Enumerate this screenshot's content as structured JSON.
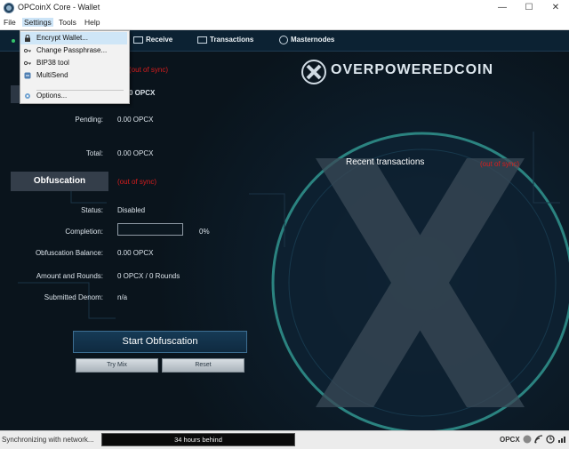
{
  "window": {
    "title": "OPCoinX Core - Wallet",
    "minimize": "—",
    "maximize": "☐",
    "close": "✕"
  },
  "menubar": [
    "File",
    "Settings",
    "Tools",
    "Help"
  ],
  "settings_menu": {
    "items": [
      "Encrypt Wallet...",
      "Change Passphrase...",
      "BIP38 tool",
      "MultiSend",
      "Options..."
    ]
  },
  "nav": {
    "receive": "Receive",
    "transactions": "Transactions",
    "masternodes": "Masternodes"
  },
  "overview": {
    "out_of_sync": "(out of sync)",
    "balance_partial": "0 OPCX",
    "pending_label": "Pending:",
    "pending_value": "0.00 OPCX",
    "total_label": "Total:",
    "total_value": "0.00 OPCX"
  },
  "obfuscation": {
    "header": "Obfuscation",
    "out_of_sync": "(out of sync)",
    "status_label": "Status:",
    "status_value": "Disabled",
    "completion_label": "Completion:",
    "completion_value": "0%",
    "completion_fraction": 0,
    "balance_label": "Obfuscation Balance:",
    "balance_value": "0.00 OPCX",
    "rounds_label": "Amount and Rounds:",
    "rounds_value": "0 OPCX / 0 Rounds",
    "denom_label": "Submitted Denom:",
    "denom_value": "n/a",
    "start_button": "Start Obfuscation",
    "try_mix_button": "Try Mix",
    "reset_button": "Reset"
  },
  "branding": {
    "logo_text": "OVERPOWEREDCOIN"
  },
  "recent": {
    "title": "Recent transactions",
    "out_of_sync": "(out of sync)"
  },
  "statusbar": {
    "sync_text": "Synchronizing with network...",
    "behind_text": "34 hours behind",
    "unit": "OPCX"
  },
  "colors": {
    "accent": "#0c2233",
    "warning": "#d81d1d",
    "panel": "#343e4a"
  }
}
